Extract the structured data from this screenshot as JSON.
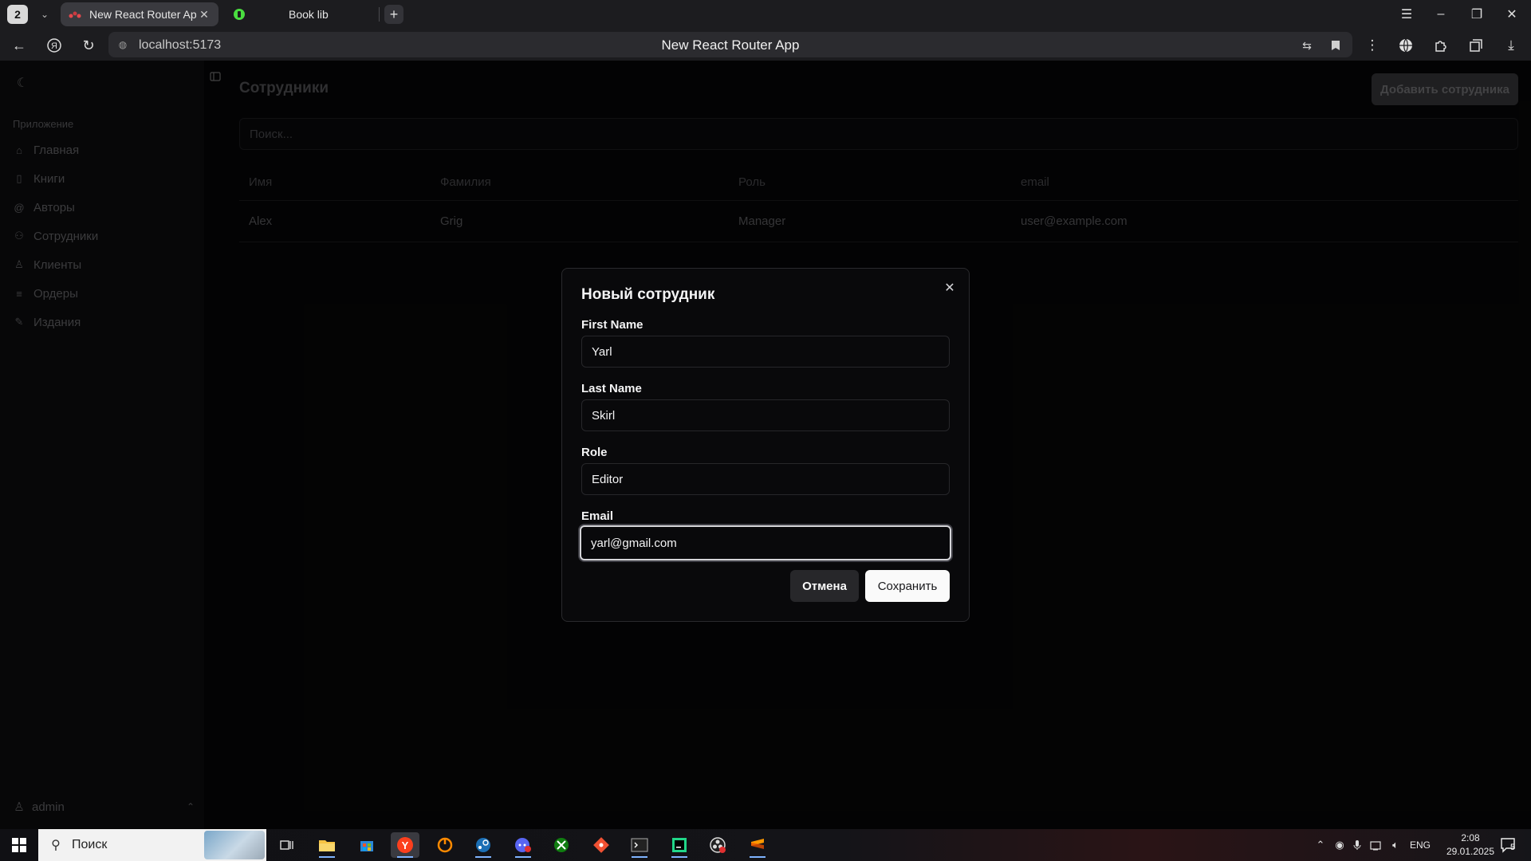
{
  "browser": {
    "tab_count": "2",
    "tabs": [
      {
        "label": "New React Router App"
      },
      {
        "label": "Book lib"
      }
    ],
    "url": "localhost:5173",
    "page_title": "New React Router App"
  },
  "sidebar": {
    "group_label": "Приложение",
    "items": [
      {
        "label": "Главная",
        "icon": "home-icon"
      },
      {
        "label": "Книги",
        "icon": "book-icon"
      },
      {
        "label": "Авторы",
        "icon": "at-sign-icon"
      },
      {
        "label": "Сотрудники",
        "icon": "users-icon"
      },
      {
        "label": "Клиенты",
        "icon": "user-icon"
      },
      {
        "label": "Ордеры",
        "icon": "list-icon"
      },
      {
        "label": "Издания",
        "icon": "pen-icon"
      }
    ],
    "user": "admin"
  },
  "main": {
    "title": "Сотрудники",
    "add_button": "Добавить сотрудника",
    "search_placeholder": "Поиск...",
    "table": {
      "headers": [
        "Имя",
        "Фамилия",
        "Роль",
        "email"
      ],
      "rows": [
        [
          "Alex",
          "Grig",
          "Manager",
          "user@example.com"
        ]
      ]
    }
  },
  "modal": {
    "title": "Новый сотрудник",
    "fields": [
      {
        "label": "First Name",
        "value": "Yarl"
      },
      {
        "label": "Last Name",
        "value": "Skirl"
      },
      {
        "label": "Role",
        "value": "Editor"
      },
      {
        "label": "Email",
        "value": "yarl@gmail.com"
      }
    ],
    "cancel_label": "Отмена",
    "save_label": "Сохранить"
  },
  "taskbar": {
    "search_label": "Поиск",
    "language": "ENG",
    "time": "2:08",
    "date": "29.01.2025",
    "notification_count": "5"
  }
}
